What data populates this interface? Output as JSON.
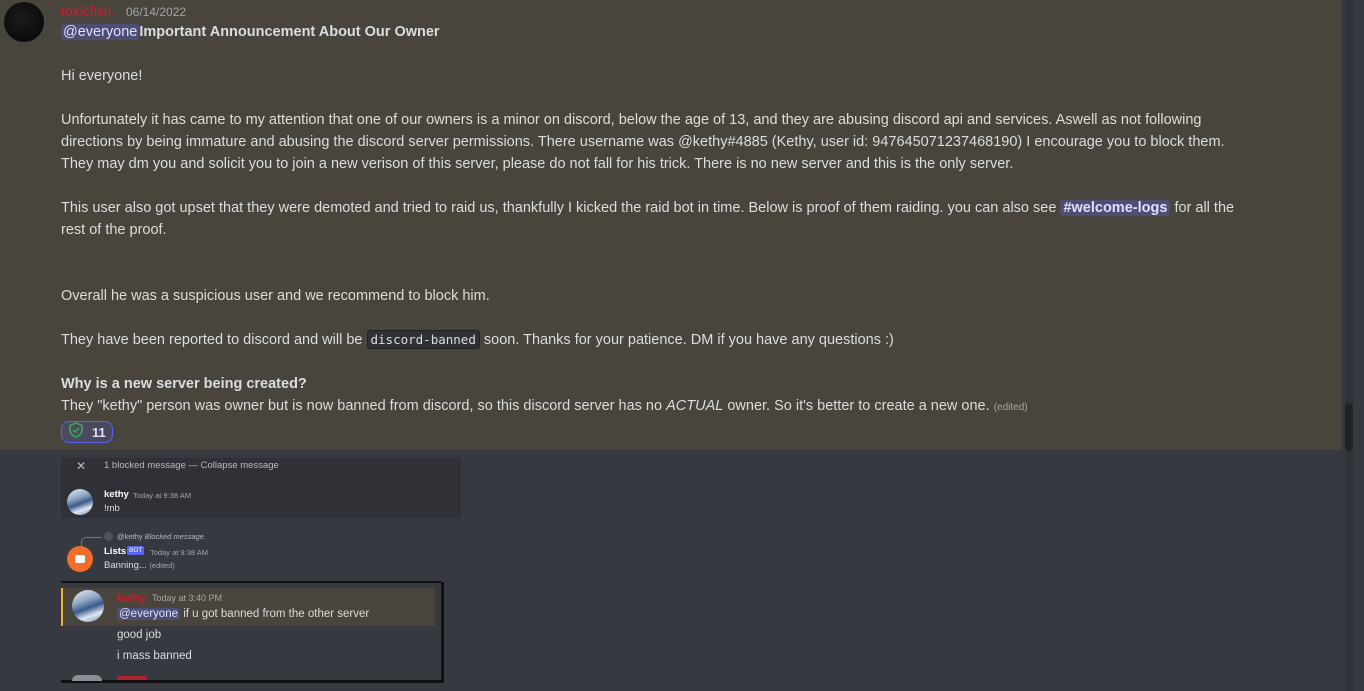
{
  "main_message": {
    "author": "toxicfish",
    "author_color": "#e0182b",
    "date": "06/14/2022",
    "header_mention": "@everyone",
    "header_title": "Important Announcement About Our Owner",
    "greeting": "Hi everyone!",
    "para1_l1": "Unfortunately it has came to my attention that one of our owners is a minor on discord, below the age of 13, and they are abusing discord api and services. Aswell as not following",
    "para1_l2": "directions by being immature and abusing the discord server permissions. There username was @kethy#4885 (Kethy, user id: 947645071237468190) I encourage you to block them.",
    "para1_l3": "They may dm you and solicit you to join a new verison of this server, please do not fall for his trick. There is no new server and this is the only server.",
    "para2_before": "This user also got upset that they were demoted and tried to raid us, thankfully I kicked the raid bot in time. Below is proof of them raiding. you can also see",
    "para2_channel": "welcome-logs",
    "para2_after": "for all the",
    "para2_l2": "rest of the proof.",
    "para3": "Overall he was a suspicious user and we recommend to block him.",
    "para4_before": "They have been reported to discord and will be",
    "para4_code": "discord-banned",
    "para4_after": "soon. Thanks for your patience. DM if you have any questions :)",
    "heading2": "Why is a new server being created?",
    "para5_before": "They \"kethy\" person was owner but is now banned from discord, so this discord server has no",
    "para5_em": "ACTUAL",
    "para5_after": "owner. So it's better to create a new one.",
    "edited_label": "(edited)",
    "reaction_icon": "shield-check-icon",
    "reaction_count": "11"
  },
  "embed1": {
    "blocked_text": "1 blocked message — Collapse message",
    "kethy_name": "kethy",
    "kethy_time": "Today at 9:38 AM",
    "kethy_msg": "!mb",
    "reply_user": "@kethy",
    "reply_text": "Blocked message.",
    "bot_name": "Lists",
    "bot_tag": "BOT",
    "bot_time": "Today at 9:38 AM",
    "bot_msg": "Banning...",
    "bot_edited": "(edited)"
  },
  "embed2": {
    "author": "kethy",
    "time": "Today at 3:40 PM",
    "mention": "@everyone",
    "msg1": "if u got banned from the other server",
    "msg2": "good job",
    "msg3": "i mass banned"
  }
}
